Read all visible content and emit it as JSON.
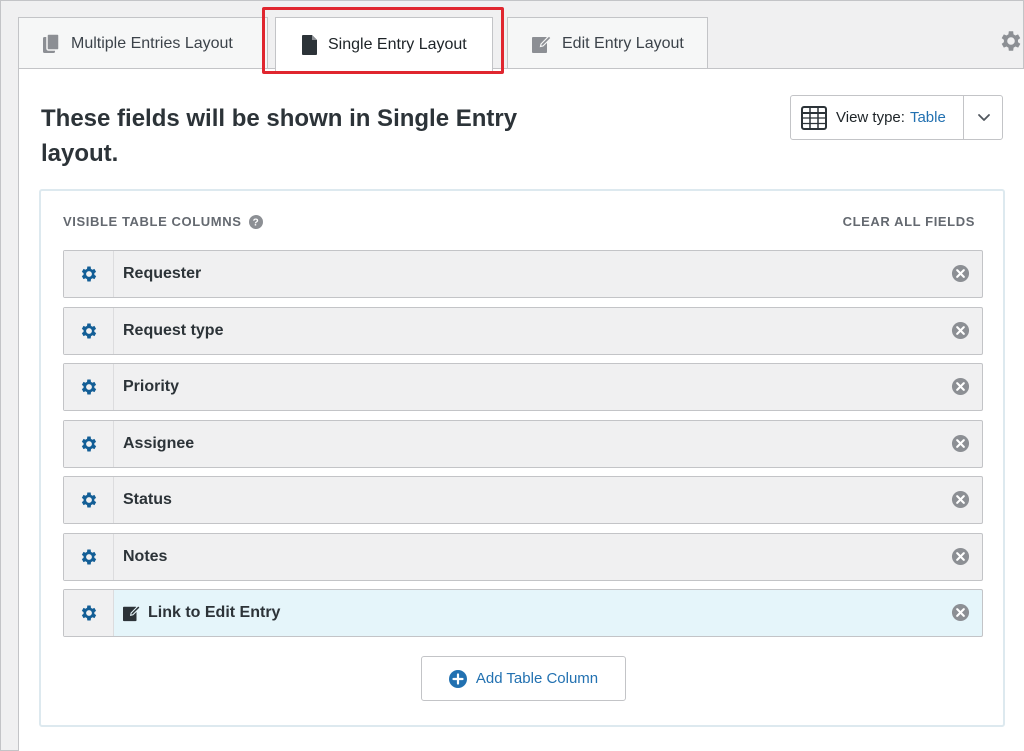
{
  "tabs": [
    {
      "label": "Multiple Entries Layout",
      "icon": "copy-icon"
    },
    {
      "label": "Single Entry Layout",
      "icon": "document-icon",
      "active": true
    },
    {
      "label": "Edit Entry Layout",
      "icon": "edit-icon"
    }
  ],
  "heading": "These fields will be shown in Single Entry layout.",
  "view_type": {
    "label": "View type:",
    "value": "Table"
  },
  "section": {
    "title": "VISIBLE TABLE COLUMNS",
    "clear_all": "CLEAR ALL FIELDS"
  },
  "fields": [
    {
      "label": "Requester"
    },
    {
      "label": "Request type"
    },
    {
      "label": "Priority"
    },
    {
      "label": "Assignee"
    },
    {
      "label": "Status"
    },
    {
      "label": "Notes"
    },
    {
      "label": "Link to Edit Entry",
      "icon": "edit-icon",
      "highlighted": true
    }
  ],
  "add_button": "Add Table Column",
  "colors": {
    "accent": "#2271b1",
    "gear": "#135e96",
    "highlight": "#e0262f",
    "row_highlight": "#e5f5fa"
  }
}
